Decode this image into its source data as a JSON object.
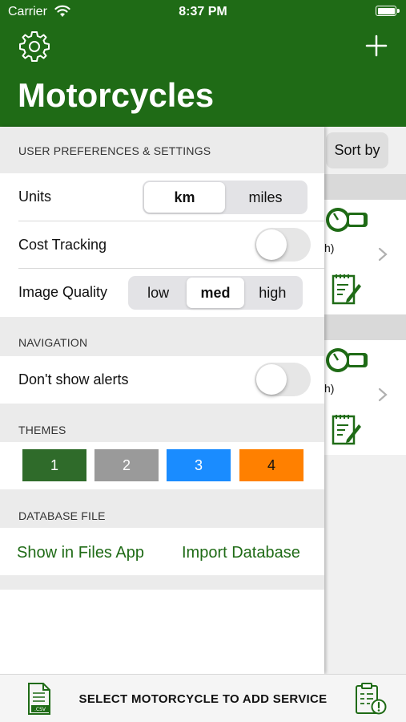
{
  "status_bar": {
    "carrier": "Carrier",
    "time": "8:37 PM"
  },
  "header": {
    "title": "Motorcycles"
  },
  "background_list": {
    "sort_label": "Sort by",
    "rows": [
      {
        "partial_text": "h)"
      },
      {
        "partial_text": "h)"
      }
    ]
  },
  "settings": {
    "user_prefs": {
      "header": "USER PREFERENCES & SETTINGS",
      "units": {
        "label": "Units",
        "options": [
          "km",
          "miles"
        ],
        "selected": "km"
      },
      "cost_tracking": {
        "label": "Cost Tracking",
        "on": false
      },
      "image_quality": {
        "label": "Image Quality",
        "options": [
          "low",
          "med",
          "high"
        ],
        "selected": "med"
      }
    },
    "navigation": {
      "header": "NAVIGATION",
      "alerts": {
        "label": "Don't show alerts",
        "on": false
      }
    },
    "themes": {
      "header": "THEMES",
      "options": [
        {
          "label": "1",
          "color": "#2f6b2a",
          "text_color": "#ffffff"
        },
        {
          "label": "2",
          "color": "#9a9a9a",
          "text_color": "#ffffff"
        },
        {
          "label": "3",
          "color": "#1a8cff",
          "text_color": "#ffffff"
        },
        {
          "label": "4",
          "color": "#ff8000",
          "text_color": "#111111"
        }
      ]
    },
    "database": {
      "header": "DATABASE FILE",
      "show_in_files": "Show in Files App",
      "import": "Import Database"
    }
  },
  "toolbar": {
    "center_text": "SELECT MOTORCYCLE TO ADD SERVICE"
  },
  "colors": {
    "brand_green": "#1f6b16",
    "header_bg": "#1f6b16"
  }
}
